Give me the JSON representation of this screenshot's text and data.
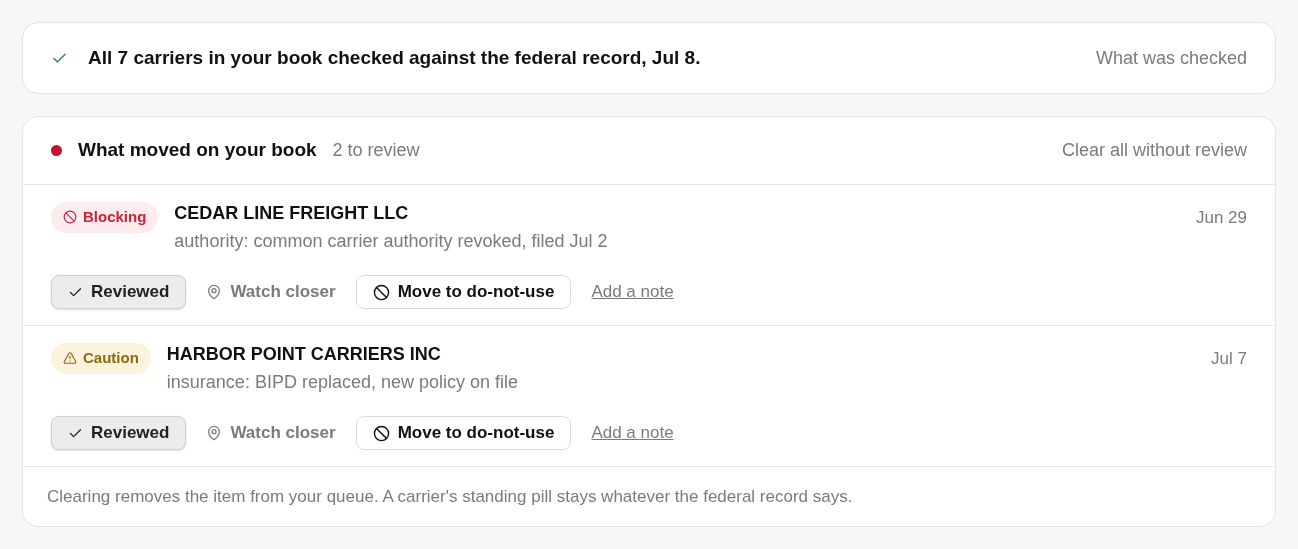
{
  "check_banner": {
    "message": "All 7 carriers in your book checked against the federal record, Jul 8.",
    "link": "What was checked"
  },
  "changes": {
    "title": "What moved on your book",
    "count": "2 to review",
    "clear_link": "Clear all without review",
    "items": [
      {
        "kind": "blocking",
        "badge": "Blocking",
        "carrier": "CEDAR LINE FREIGHT LLC",
        "detail": "authority: common carrier authority revoked, filed Jul 2",
        "date": "Jun 29",
        "actions": {
          "reviewed": "Reviewed",
          "watch": "Watch closer",
          "move": "Move to do-not-use",
          "note": "Add a note"
        }
      },
      {
        "kind": "caution",
        "badge": "Caution",
        "carrier": "HARBOR POINT CARRIERS INC",
        "detail": "insurance: BIPD replaced, new policy on file",
        "date": "Jul 7",
        "actions": {
          "reviewed": "Reviewed",
          "watch": "Watch closer",
          "move": "Move to do-not-use",
          "note": "Add a note"
        }
      }
    ],
    "footer": "Clearing removes the item from your queue. A carrier's standing pill stays whatever the federal record says."
  }
}
